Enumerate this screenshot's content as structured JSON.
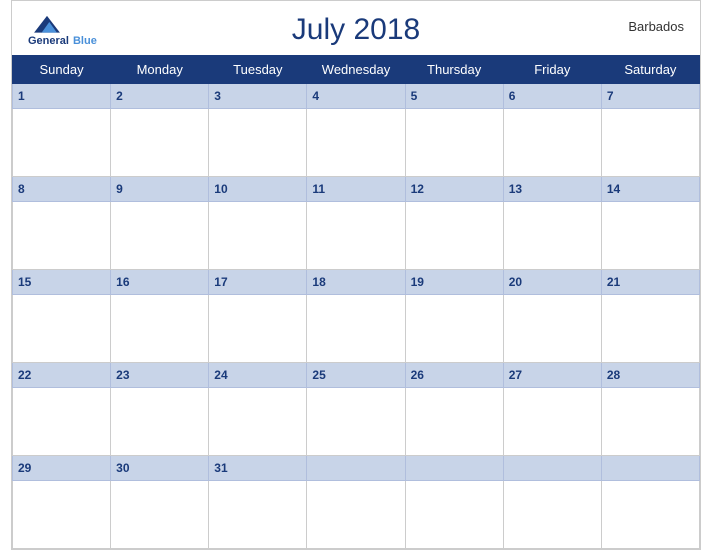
{
  "calendar": {
    "title": "July 2018",
    "country": "Barbados",
    "days_of_week": [
      "Sunday",
      "Monday",
      "Tuesday",
      "Wednesday",
      "Thursday",
      "Friday",
      "Saturday"
    ],
    "weeks": [
      {
        "days": [
          {
            "date": 1,
            "empty": false
          },
          {
            "date": 2,
            "empty": false
          },
          {
            "date": 3,
            "empty": false
          },
          {
            "date": 4,
            "empty": false
          },
          {
            "date": 5,
            "empty": false
          },
          {
            "date": 6,
            "empty": false
          },
          {
            "date": 7,
            "empty": false
          }
        ]
      },
      {
        "days": [
          {
            "date": 8,
            "empty": false
          },
          {
            "date": 9,
            "empty": false
          },
          {
            "date": 10,
            "empty": false
          },
          {
            "date": 11,
            "empty": false
          },
          {
            "date": 12,
            "empty": false
          },
          {
            "date": 13,
            "empty": false
          },
          {
            "date": 14,
            "empty": false
          }
        ]
      },
      {
        "days": [
          {
            "date": 15,
            "empty": false
          },
          {
            "date": 16,
            "empty": false
          },
          {
            "date": 17,
            "empty": false
          },
          {
            "date": 18,
            "empty": false
          },
          {
            "date": 19,
            "empty": false
          },
          {
            "date": 20,
            "empty": false
          },
          {
            "date": 21,
            "empty": false
          }
        ]
      },
      {
        "days": [
          {
            "date": 22,
            "empty": false
          },
          {
            "date": 23,
            "empty": false
          },
          {
            "date": 24,
            "empty": false
          },
          {
            "date": 25,
            "empty": false
          },
          {
            "date": 26,
            "empty": false
          },
          {
            "date": 27,
            "empty": false
          },
          {
            "date": 28,
            "empty": false
          }
        ]
      },
      {
        "days": [
          {
            "date": 29,
            "empty": false
          },
          {
            "date": 30,
            "empty": false
          },
          {
            "date": 31,
            "empty": false
          },
          {
            "date": null,
            "empty": true
          },
          {
            "date": null,
            "empty": true
          },
          {
            "date": null,
            "empty": true
          },
          {
            "date": null,
            "empty": true
          }
        ]
      }
    ],
    "logo": {
      "line1": "General",
      "line2": "Blue"
    }
  }
}
